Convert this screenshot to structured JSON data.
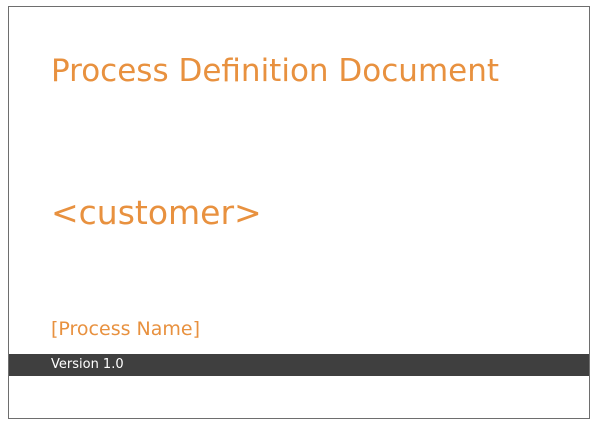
{
  "document": {
    "title": "Process Definition Document",
    "customer": "<customer>",
    "process_name": "[Process Name]",
    "version": "Version 1.0"
  },
  "colors": {
    "accent": "#e8913f",
    "bar": "#3f3f3f",
    "border": "#6e6e6e"
  }
}
